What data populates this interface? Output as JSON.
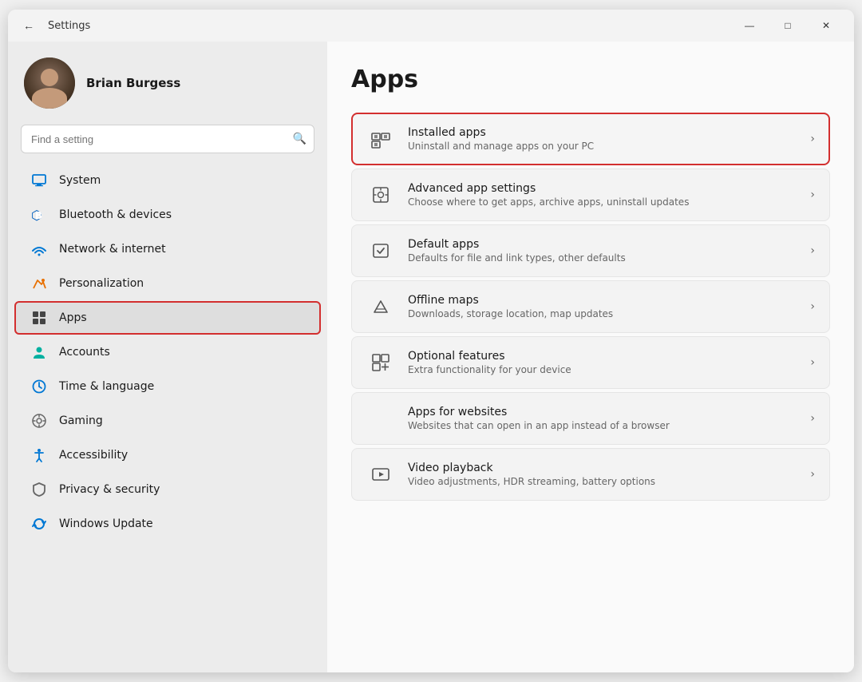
{
  "window": {
    "title": "Settings",
    "controls": {
      "minimize": "—",
      "maximize": "□",
      "close": "✕"
    }
  },
  "user": {
    "name": "Brian Burgess"
  },
  "search": {
    "placeholder": "Find a setting"
  },
  "nav": {
    "items": [
      {
        "id": "system",
        "label": "System",
        "icon": "🖥️"
      },
      {
        "id": "bluetooth",
        "label": "Bluetooth & devices",
        "icon": "🔵"
      },
      {
        "id": "network",
        "label": "Network & internet",
        "icon": "📶"
      },
      {
        "id": "personalization",
        "label": "Personalization",
        "icon": "✏️"
      },
      {
        "id": "apps",
        "label": "Apps",
        "icon": "📦",
        "active": true
      },
      {
        "id": "accounts",
        "label": "Accounts",
        "icon": "👤"
      },
      {
        "id": "time",
        "label": "Time & language",
        "icon": "🕐"
      },
      {
        "id": "gaming",
        "label": "Gaming",
        "icon": "🎮"
      },
      {
        "id": "accessibility",
        "label": "Accessibility",
        "icon": "♿"
      },
      {
        "id": "privacy",
        "label": "Privacy & security",
        "icon": "🛡️"
      },
      {
        "id": "update",
        "label": "Windows Update",
        "icon": "🔄"
      }
    ]
  },
  "main": {
    "page_title": "Apps",
    "settings": [
      {
        "id": "installed-apps",
        "title": "Installed apps",
        "desc": "Uninstall and manage apps on your PC",
        "icon": "installed-apps-icon",
        "highlighted": true
      },
      {
        "id": "advanced-app-settings",
        "title": "Advanced app settings",
        "desc": "Choose where to get apps, archive apps, uninstall updates",
        "icon": "advanced-apps-icon",
        "highlighted": false
      },
      {
        "id": "default-apps",
        "title": "Default apps",
        "desc": "Defaults for file and link types, other defaults",
        "icon": "default-apps-icon",
        "highlighted": false
      },
      {
        "id": "offline-maps",
        "title": "Offline maps",
        "desc": "Downloads, storage location, map updates",
        "icon": "offline-maps-icon",
        "highlighted": false
      },
      {
        "id": "optional-features",
        "title": "Optional features",
        "desc": "Extra functionality for your device",
        "icon": "optional-features-icon",
        "highlighted": false
      },
      {
        "id": "apps-for-websites",
        "title": "Apps for websites",
        "desc": "Websites that can open in an app instead of a browser",
        "icon": "apps-websites-icon",
        "highlighted": false
      },
      {
        "id": "video-playback",
        "title": "Video playback",
        "desc": "Video adjustments, HDR streaming, battery options",
        "icon": "video-playback-icon",
        "highlighted": false
      }
    ]
  }
}
